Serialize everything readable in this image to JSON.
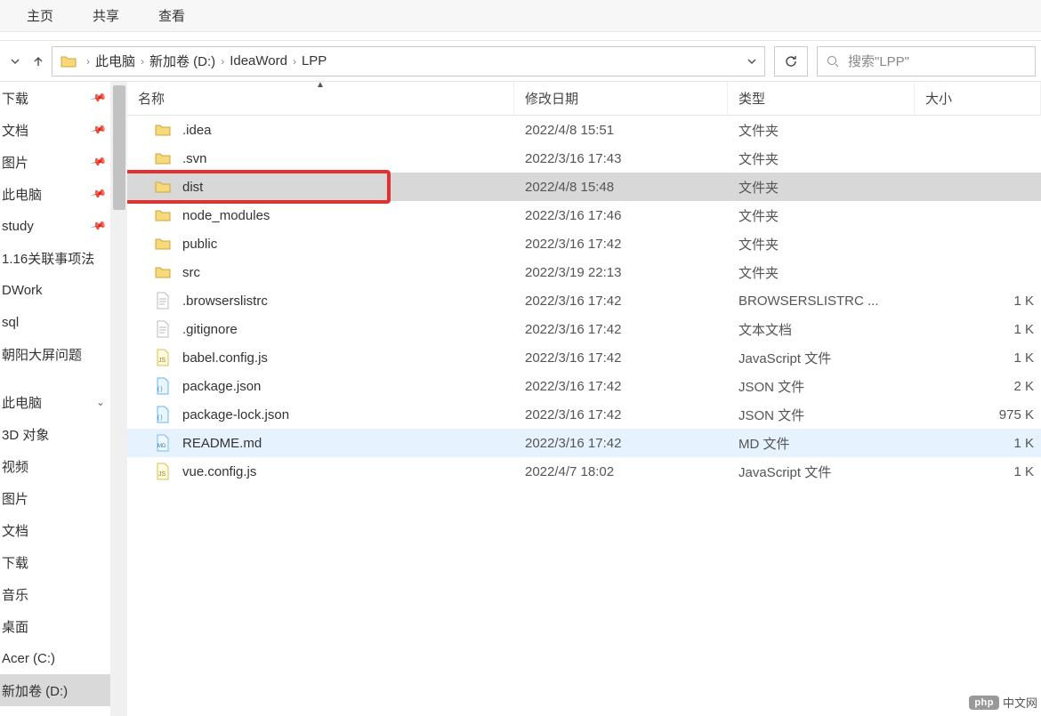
{
  "ribbon": {
    "tabs": [
      "主页",
      "共享",
      "查看"
    ]
  },
  "breadcrumb": {
    "root_icon": "folder",
    "items": [
      "此电脑",
      "新加卷 (D:)",
      "IdeaWord",
      "LPP"
    ]
  },
  "refresh_title": "刷新",
  "search": {
    "placeholder": "搜索\"LPP\""
  },
  "sidebar": {
    "items": [
      {
        "label": "下载",
        "pinned": true
      },
      {
        "label": "文档",
        "pinned": true
      },
      {
        "label": "图片",
        "pinned": true
      },
      {
        "label": "此电脑",
        "pinned": true
      },
      {
        "label": "study",
        "pinned": true
      },
      {
        "label": "1.16关联事项法",
        "pinned": false
      },
      {
        "label": "DWork",
        "pinned": false
      },
      {
        "label": "sql",
        "pinned": false
      },
      {
        "label": "朝阳大屏问题",
        "pinned": false
      },
      {
        "label": "",
        "pinned": false,
        "spacer": true
      },
      {
        "label": "此电脑",
        "pinned": false,
        "chev": true
      },
      {
        "label": "3D 对象",
        "pinned": false
      },
      {
        "label": "视频",
        "pinned": false
      },
      {
        "label": "图片",
        "pinned": false
      },
      {
        "label": "文档",
        "pinned": false
      },
      {
        "label": "下载",
        "pinned": false
      },
      {
        "label": "音乐",
        "pinned": false
      },
      {
        "label": "桌面",
        "pinned": false
      },
      {
        "label": "Acer (C:)",
        "pinned": false
      },
      {
        "label": "新加卷 (D:)",
        "pinned": false,
        "selected": true
      }
    ]
  },
  "columns": {
    "name": "名称",
    "date": "修改日期",
    "type": "类型",
    "size": "大小",
    "sort": "name-asc"
  },
  "files": [
    {
      "icon": "folder",
      "name": ".idea",
      "date": "2022/4/8 15:51",
      "type": "文件夹",
      "size": ""
    },
    {
      "icon": "folder",
      "name": ".svn",
      "date": "2022/3/16 17:43",
      "type": "文件夹",
      "size": ""
    },
    {
      "icon": "folder",
      "name": "dist",
      "date": "2022/4/8 15:48",
      "type": "文件夹",
      "size": "",
      "selected": true,
      "highlighted": true
    },
    {
      "icon": "folder",
      "name": "node_modules",
      "date": "2022/3/16 17:46",
      "type": "文件夹",
      "size": ""
    },
    {
      "icon": "folder",
      "name": "public",
      "date": "2022/3/16 17:42",
      "type": "文件夹",
      "size": ""
    },
    {
      "icon": "folder",
      "name": "src",
      "date": "2022/3/19 22:13",
      "type": "文件夹",
      "size": ""
    },
    {
      "icon": "text",
      "name": ".browserslistrc",
      "date": "2022/3/16 17:42",
      "type": "BROWSERSLISTRC ...",
      "size": "1 K"
    },
    {
      "icon": "text",
      "name": ".gitignore",
      "date": "2022/3/16 17:42",
      "type": "文本文档",
      "size": "1 K"
    },
    {
      "icon": "js",
      "name": "babel.config.js",
      "date": "2022/3/16 17:42",
      "type": "JavaScript 文件",
      "size": "1 K"
    },
    {
      "icon": "json",
      "name": "package.json",
      "date": "2022/3/16 17:42",
      "type": "JSON 文件",
      "size": "2 K"
    },
    {
      "icon": "json",
      "name": "package-lock.json",
      "date": "2022/3/16 17:42",
      "type": "JSON 文件",
      "size": "975 K"
    },
    {
      "icon": "md",
      "name": "README.md",
      "date": "2022/3/16 17:42",
      "type": "MD 文件",
      "size": "1 K",
      "hover": true
    },
    {
      "icon": "js",
      "name": "vue.config.js",
      "date": "2022/4/7 18:02",
      "type": "JavaScript 文件",
      "size": "1 K"
    }
  ],
  "watermark": {
    "badge": "php",
    "text": "中文网"
  }
}
